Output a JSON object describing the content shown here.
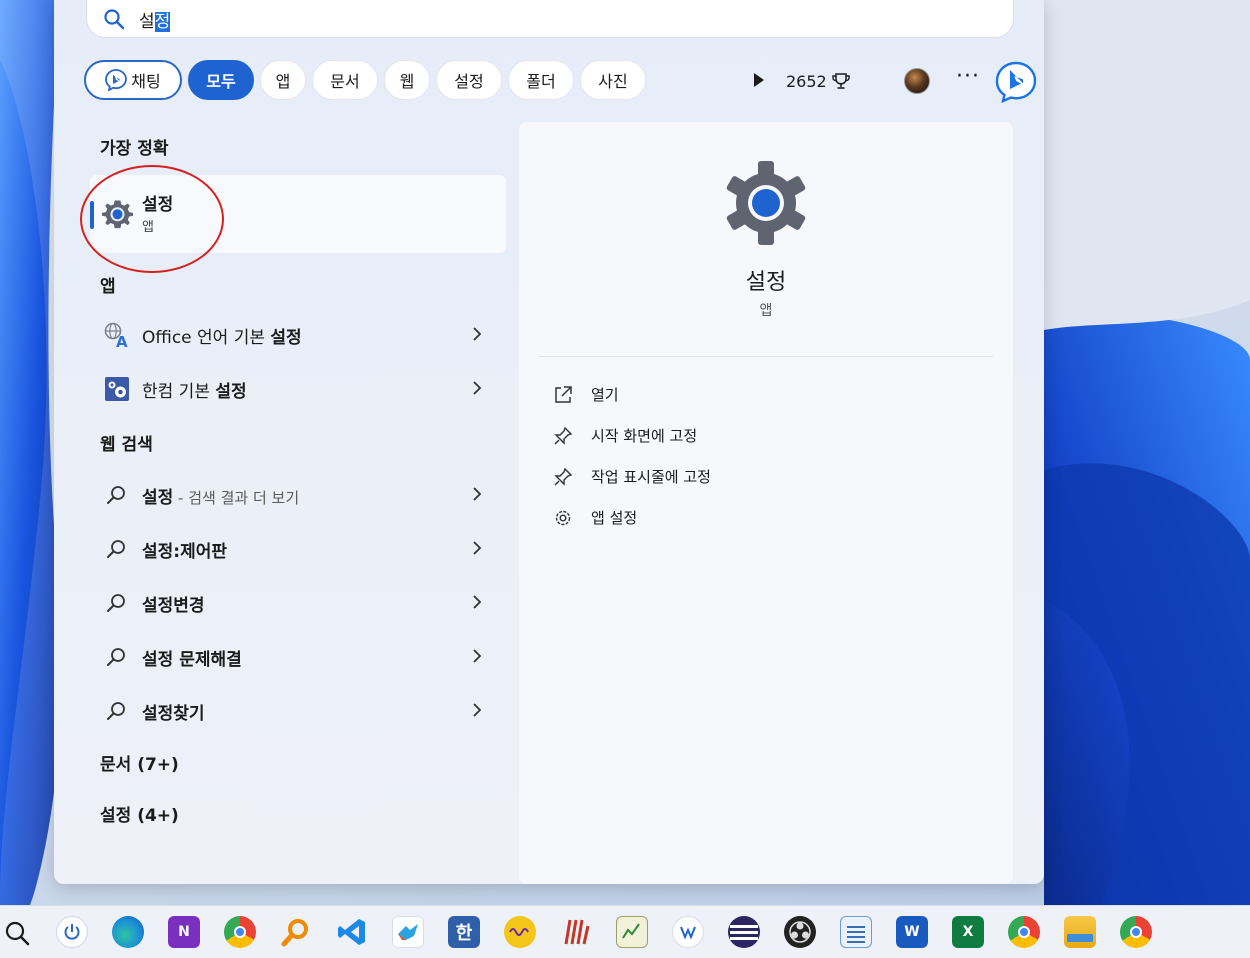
{
  "search": {
    "query_selected_part": "정",
    "query_plain_part": "설"
  },
  "filters": {
    "chat_label": "채팅",
    "chips": [
      "모두",
      "앱",
      "문서",
      "웹",
      "설정",
      "폴더",
      "사진"
    ],
    "active_chip": "모두",
    "points": "2652"
  },
  "left": {
    "best_match_title": "가장 정확",
    "best_match": {
      "name": "설정",
      "type": "앱"
    },
    "apps_title": "앱",
    "apps": [
      {
        "pre": "Office 언어 기본 ",
        "bold": "설정",
        "icon": "office-language-icon"
      },
      {
        "pre": "한컴 기본 ",
        "bold": "설정",
        "icon": "hancom-settings-icon"
      }
    ],
    "web_title": "웹 검색",
    "web": [
      {
        "bold": "설정",
        "suffix": " - 검색 결과 더 보기"
      },
      {
        "bold": "설정:제어판",
        "suffix": ""
      },
      {
        "bold": "설정변경",
        "suffix": ""
      },
      {
        "bold": "설정 문제해결",
        "suffix": ""
      },
      {
        "bold": "설정찾기",
        "suffix": ""
      }
    ],
    "docs_title": "문서 (7+)",
    "settings_title": "설정 (4+)"
  },
  "right": {
    "name": "설정",
    "type": "앱",
    "actions": [
      {
        "label": "열기",
        "icon": "open-external-icon"
      },
      {
        "label": "시작 화면에 고정",
        "icon": "pin-icon"
      },
      {
        "label": "작업 표시줄에 고정",
        "icon": "pin-icon"
      },
      {
        "label": "앱 설정",
        "icon": "gear-icon"
      }
    ]
  },
  "taskbar": {
    "icons": [
      "search-icon",
      "power-icon",
      "edge-icon",
      "onenote-icon",
      "chrome-icon",
      "search-app-icon",
      "vscode-icon",
      "app-icon",
      "hancom-icon",
      "audio-app-icon",
      "app-icon",
      "notepad-app-icon",
      "app-icon",
      "eclipse-icon",
      "obs-icon",
      "notepad-icon",
      "word-icon",
      "excel-icon",
      "chrome-profile-icon",
      "file-explorer-icon",
      "chrome-profile-icon"
    ]
  },
  "colors": {
    "accent": "#1e63d0",
    "annotation": "#d62020"
  }
}
